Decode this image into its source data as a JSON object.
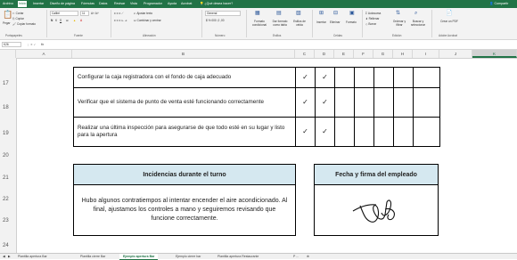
{
  "ribbon_tabs": [
    "Archivo",
    "Inicio",
    "Insertar",
    "Diseño de página",
    "Fórmulas",
    "Datos",
    "Revisar",
    "Vista",
    "Programador",
    "Ayuda",
    "Acrobat",
    "¿Qué desea hacer?"
  ],
  "share_label": "Compartir",
  "clipboard": {
    "paste": "Pegar",
    "cut": "Cortar",
    "copy": "Copiar",
    "format_painter": "Copiar formato",
    "group": "Portapapeles"
  },
  "font": {
    "name": "Calibri",
    "size": "11",
    "group": "Fuente"
  },
  "alignment": {
    "wrap": "Ajustar texto",
    "merge": "Combinar y centrar",
    "group": "Alineación"
  },
  "number": {
    "format": "General",
    "group": "Número"
  },
  "styles": {
    "conditional": "Formato condicional",
    "table": "Dar formato como tabla",
    "cell": "Estilos de celda",
    "group": "Estilos"
  },
  "cells": {
    "insert": "Insertar",
    "delete": "Eliminar",
    "format": "Formato",
    "group": "Celdas"
  },
  "editing": {
    "autosum": "Autosuma",
    "fill": "Rellenar",
    "clear": "Borrar",
    "sort": "Ordenar y filtrar",
    "find": "Buscar y seleccionar",
    "group": "Edición"
  },
  "adobe": {
    "create": "Crear un PDF",
    "group": "Adobe Acrobat"
  },
  "formula_bar": {
    "name_box": "K26",
    "fx": "fx",
    "value": ""
  },
  "columns": [
    "A",
    "B",
    "C",
    "D",
    "E",
    "F",
    "G",
    "H",
    "I",
    "J",
    "K"
  ],
  "rows": [
    "17",
    "18",
    "19",
    "20",
    "21",
    "22",
    "23",
    "24"
  ],
  "tasks": [
    {
      "text": "Configurar la caja registradora con el fondo de caja adecuado",
      "c": "✓",
      "d": "✓"
    },
    {
      "text": "Verificar que el sistema de punto de venta esté funcionando correctamente",
      "c": "✓",
      "d": "✓"
    },
    {
      "text": "Realizar una última inspección para asegurarse de que todo esté en su lugar y listo para la apertura",
      "c": "✓",
      "d": "✓"
    }
  ],
  "incidents": {
    "title": "Incidencias durante el turno",
    "body": "Hubo algunos contratiempos al intentar encender el aire acondicionado. Al final, ajustamos los controles a mano y seguiremos revisando que funcione correctamente."
  },
  "signature": {
    "title": "Fecha y firma del empleado"
  },
  "sheet_tabs": [
    "Plantilla apertura Bar",
    "Plantilla cierre Bar",
    "Ejemplo apertura Bar",
    "Ejemplo cierre bar",
    "Plantilla apertura Restaurante",
    "P ..."
  ],
  "active_sheet_index": 2
}
